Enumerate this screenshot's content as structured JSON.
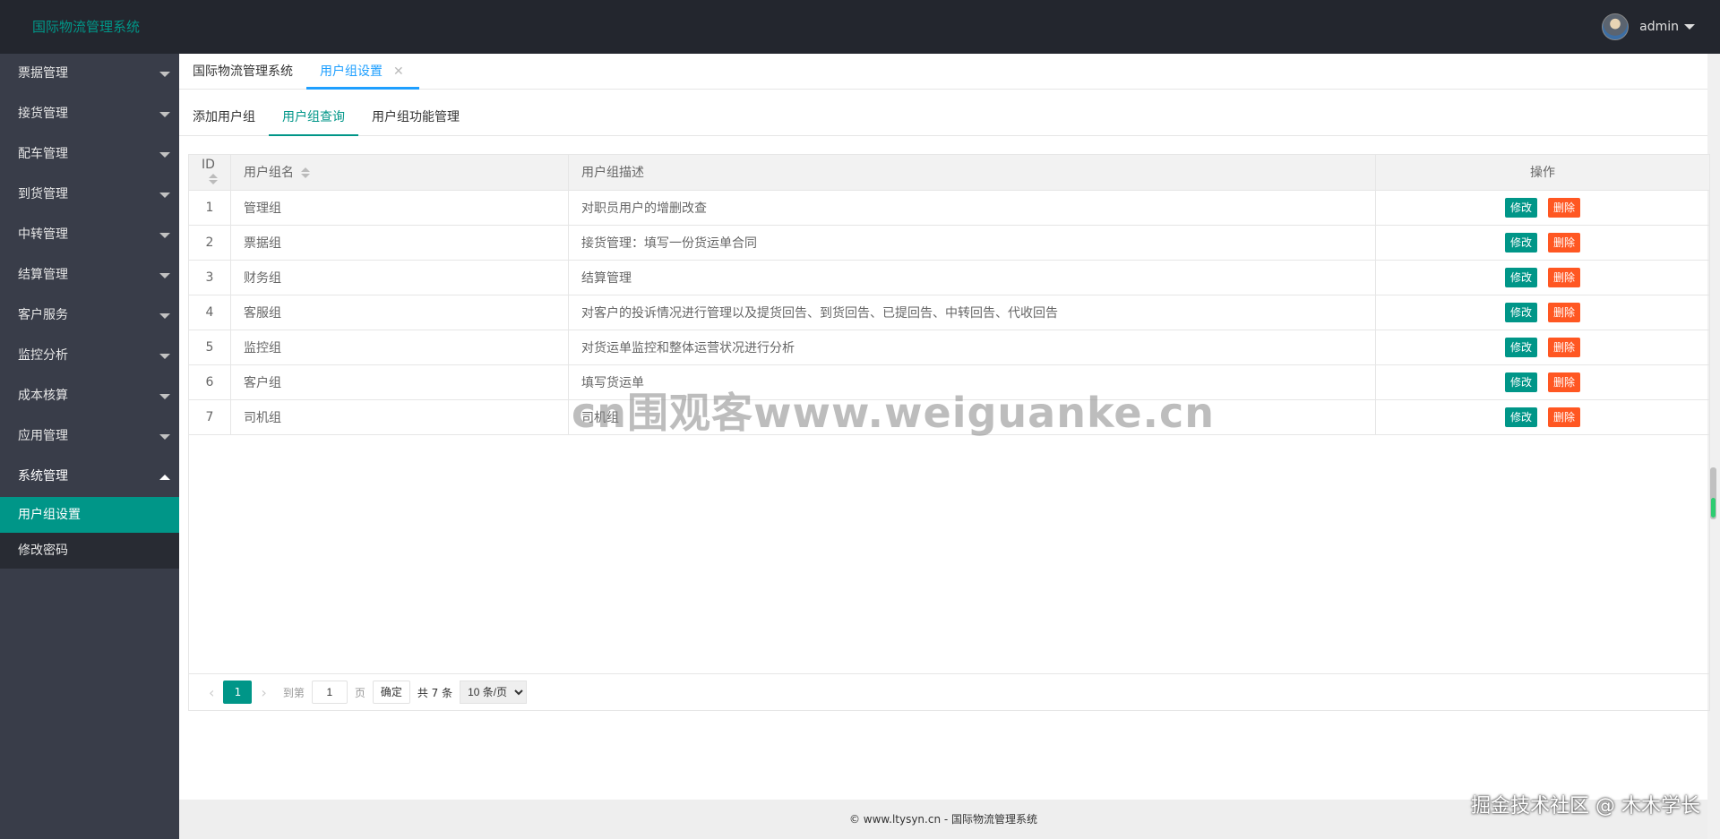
{
  "header": {
    "title": "国际物流管理系统",
    "username": "admin"
  },
  "sidebar": {
    "items": [
      {
        "label": "票据管理"
      },
      {
        "label": "接货管理"
      },
      {
        "label": "配车管理"
      },
      {
        "label": "到货管理"
      },
      {
        "label": "中转管理"
      },
      {
        "label": "结算管理"
      },
      {
        "label": "客户服务"
      },
      {
        "label": "监控分析"
      },
      {
        "label": "成本核算"
      },
      {
        "label": "应用管理"
      }
    ],
    "open_group": {
      "label": "系统管理",
      "children": [
        {
          "label": "用户组设置"
        },
        {
          "label": "修改密码"
        }
      ]
    }
  },
  "tabs": {
    "home": "国际物流管理系统",
    "active": "用户组设置"
  },
  "subtabs": [
    "添加用户组",
    "用户组查询",
    "用户组功能管理"
  ],
  "table": {
    "headers": [
      "ID",
      "用户组名",
      "用户组描述",
      "操作"
    ],
    "rows": [
      {
        "id": "1",
        "name": "管理组",
        "desc": "对职员用户的增删改查"
      },
      {
        "id": "2",
        "name": "票据组",
        "desc": "接货管理：填写一份货运单合同"
      },
      {
        "id": "3",
        "name": "财务组",
        "desc": "结算管理"
      },
      {
        "id": "4",
        "name": "客服组",
        "desc": "对客户的投诉情况进行管理以及提货回告、到货回告、已提回告、中转回告、代收回告"
      },
      {
        "id": "5",
        "name": "监控组",
        "desc": "对货运单监控和整体运营状况进行分析"
      },
      {
        "id": "6",
        "name": "客户组",
        "desc": "填写货运单"
      },
      {
        "id": "7",
        "name": "司机组",
        "desc": "司机组"
      }
    ],
    "edit_label": "修改",
    "delete_label": "删除"
  },
  "pager": {
    "current_page": "1",
    "goto_label": "到第",
    "page_label": "页",
    "input_value": "1",
    "confirm_label": "确定",
    "total_label": "共 7 条",
    "page_size": "10 条/页"
  },
  "footer": {
    "text": "© www.ltysyn.cn - 国际物流管理系统"
  },
  "watermarks": {
    "center": "cn围观客www.weiguanke.cn",
    "corner": "掘金技术社区 @ 木木学长"
  },
  "colors": {
    "primary": "#009688",
    "danger": "#ff5722",
    "tab_active": "#1e9fff",
    "sidebar_bg": "#393d49",
    "header_bg": "#23262e"
  }
}
